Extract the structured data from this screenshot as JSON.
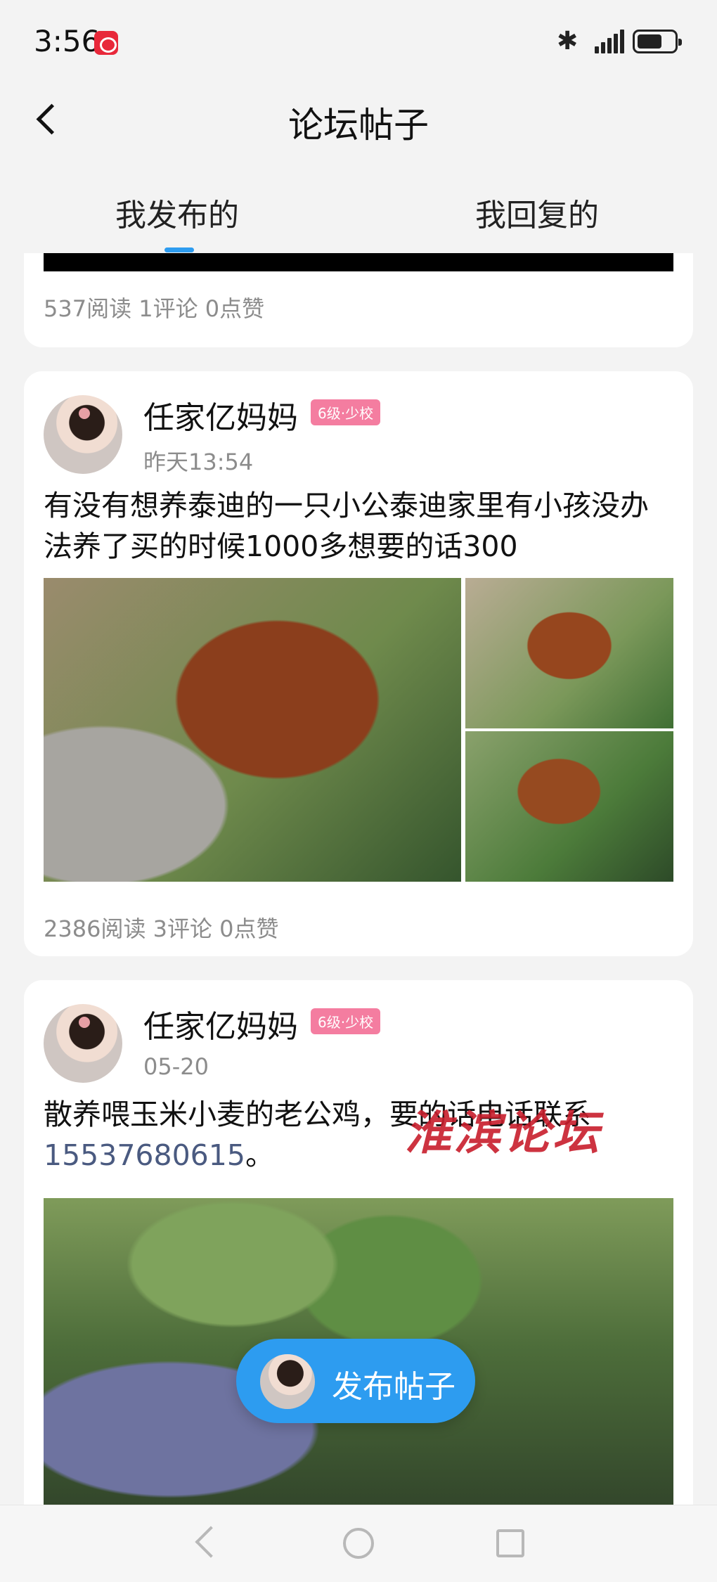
{
  "status": {
    "time": "3:56"
  },
  "nav": {
    "title": "论坛帖子"
  },
  "tabs": [
    {
      "label": "我发布的"
    },
    {
      "label": "我回复的"
    }
  ],
  "posts": [
    {
      "stats": "537阅读 1评论 0点赞"
    },
    {
      "user": "任家亿妈妈",
      "level": "6级·少校",
      "date": "昨天13:54",
      "text": "有没有想养泰迪的一只小公泰迪家里有小孩没办法养了买的时候1000多想要的话300",
      "stats": "2386阅读 3评论 0点赞"
    },
    {
      "user": "任家亿妈妈",
      "level": "6级·少校",
      "date": "05-20",
      "text": "散养喂玉米小麦的老公鸡，要的话电话联系",
      "phone": "15537680615",
      "text_end": "。"
    }
  ],
  "fab": {
    "label": "发布帖子"
  },
  "watermark": "淮滨论坛"
}
